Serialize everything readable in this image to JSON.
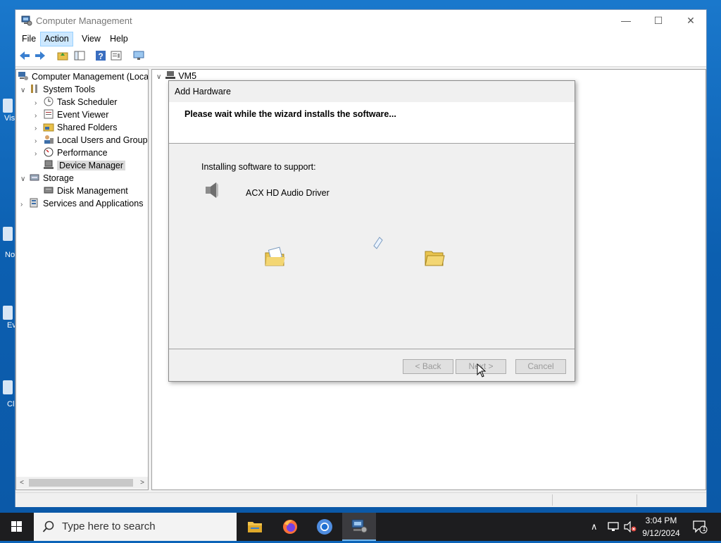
{
  "window": {
    "title": "Computer Management",
    "minimize": "—",
    "maximize": "☐",
    "close": "✕"
  },
  "menu": [
    "File",
    "Action",
    "View",
    "Help"
  ],
  "tree": {
    "root": "Computer Management (Local",
    "system_tools": "System Tools",
    "task_scheduler": "Task Scheduler",
    "event_viewer": "Event Viewer",
    "shared_folders": "Shared Folders",
    "local_users": "Local Users and Groups",
    "performance": "Performance",
    "device_manager": "Device Manager",
    "storage": "Storage",
    "disk_management": "Disk Management",
    "services_apps": "Services and Applications"
  },
  "main": {
    "vm_label": "VM5"
  },
  "dialog": {
    "title": "Add Hardware",
    "header_msg": "Please wait while the wizard installs the software...",
    "support_label": "Installing software to support:",
    "driver_name": "ACX HD Audio Driver",
    "back": "< Back",
    "next": "Next >",
    "cancel": "Cancel"
  },
  "desktop_icons": [
    "Vis",
    "No",
    "Ev",
    "Cl"
  ],
  "taskbar": {
    "search_placeholder": "Type here to search",
    "time": "3:04 PM",
    "date": "9/12/2024",
    "notification_count": "1"
  },
  "colors": {
    "taskbar": "#1d1d1f",
    "desktop": "#0c64b8",
    "selection": "#cde8ff",
    "active_app_underline": "#76b9ed"
  }
}
